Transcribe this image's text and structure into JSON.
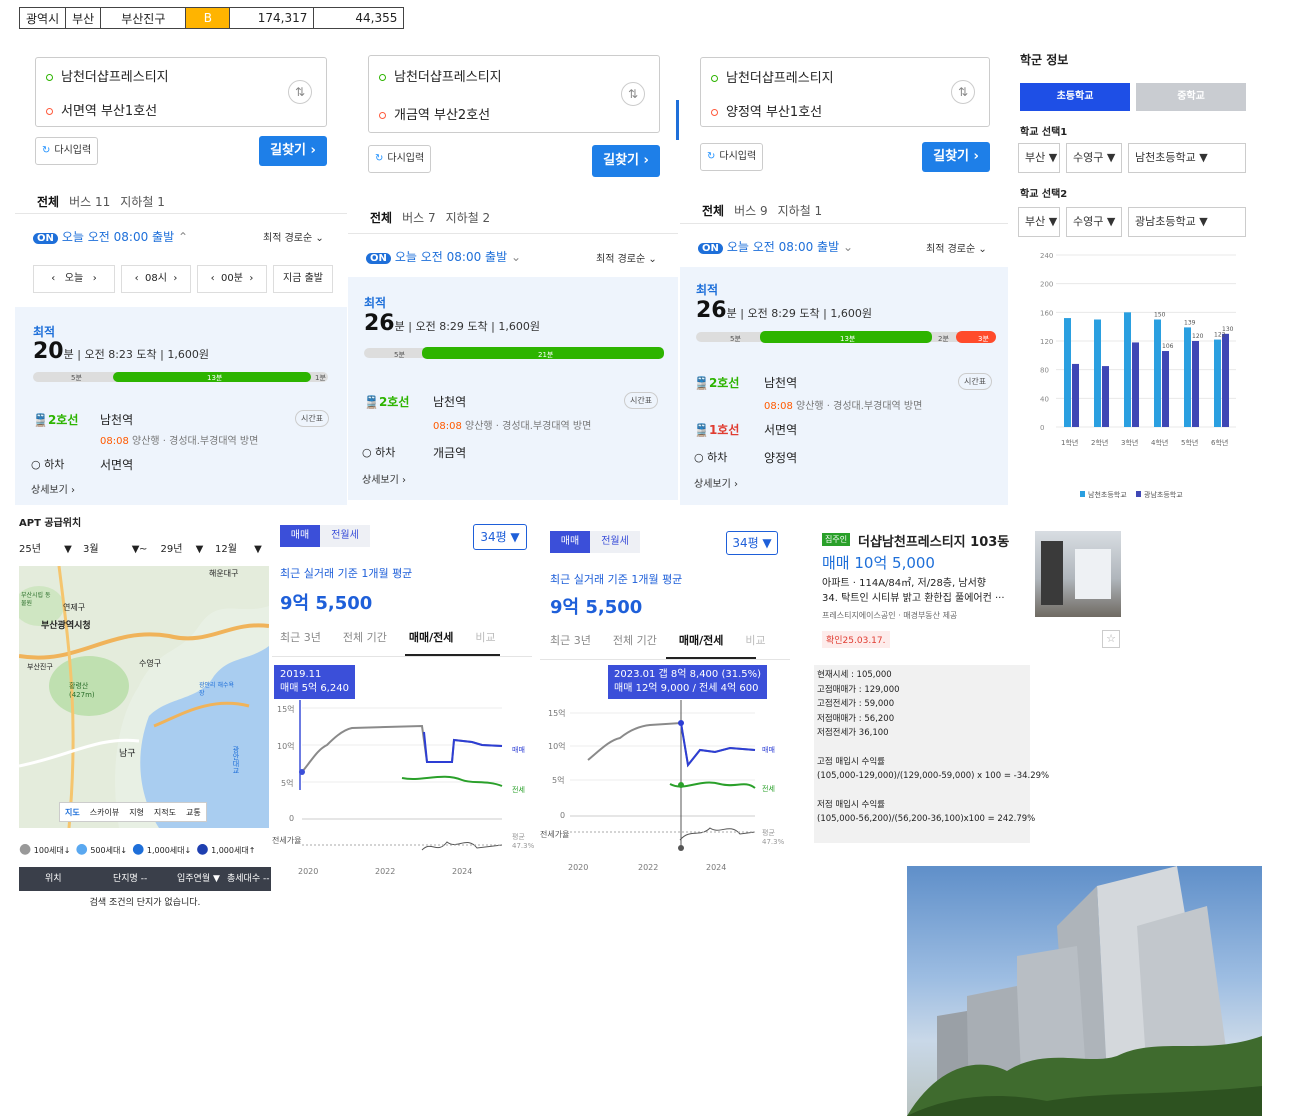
{
  "top_table": [
    "광역시",
    "부산",
    "부산진구",
    "B",
    "174,317",
    "44,355"
  ],
  "routes": [
    {
      "origin": "남천더샵프레스티지",
      "dest": "서면역 부산1호선",
      "reset": "다시입력",
      "find": "길찾기 ›",
      "tabs": [
        "전체",
        "버스 11",
        "지하철 1"
      ],
      "on": "ON",
      "depart": "오늘 오전 08:00 출발",
      "sort": "최적 경로순",
      "time_picker": [
        "‹",
        "오늘",
        "›",
        "‹",
        "08시",
        "›",
        "‹",
        "00분",
        "›",
        "지금 출발"
      ],
      "best": "최적",
      "min": "20",
      "min_unit": "분",
      "arrive": "오전 8:23 도착",
      "fare": "1,600원",
      "seg": [
        "5분",
        "13분",
        "1분"
      ],
      "line": "2호선",
      "station": "남천역",
      "dir_time": "08:08",
      "dir_rest": "양산행 · 경성대.부경대역 방면",
      "tt": "시간표",
      "off": "하차",
      "off_station": "서면역",
      "more": "상세보기 ›"
    },
    {
      "origin": "남천더샵프레스티지",
      "dest": "개금역 부산2호선",
      "reset": "다시입력",
      "find": "길찾기 ›",
      "tabs": [
        "전체",
        "버스 7",
        "지하철 2"
      ],
      "on": "ON",
      "depart": "오늘 오전 08:00 출발",
      "sort": "최적 경로순",
      "best": "최적",
      "min": "26",
      "min_unit": "분",
      "arrive": "오전 8:29 도착",
      "fare": "1,600원",
      "seg": [
        "5분",
        "21분"
      ],
      "line": "2호선",
      "station": "남천역",
      "dir_time": "08:08",
      "dir_rest": "양산행 · 경성대.부경대역 방면",
      "tt": "시간표",
      "off": "하차",
      "off_station": "개금역",
      "more": "상세보기 ›"
    },
    {
      "origin": "남천더샵프레스티지",
      "dest": "양정역 부산1호선",
      "reset": "다시입력",
      "find": "길찾기 ›",
      "tabs": [
        "전체",
        "버스 9",
        "지하철 1"
      ],
      "on": "ON",
      "depart": "오늘 오전 08:00 출발",
      "sort": "최적 경로순",
      "best": "최적",
      "min": "26",
      "min_unit": "분",
      "arrive": "오전 8:29 도착",
      "fare": "1,600원",
      "seg": [
        "5분",
        "13분",
        "2분",
        "3분"
      ],
      "line": "2호선",
      "station": "남천역",
      "dir_time": "08:08",
      "dir_rest": "양산행 · 경성대.부경대역 방면",
      "tt": "시간표",
      "line_b": "1호선",
      "station_b": "서면역",
      "off": "하차",
      "off_station": "양정역",
      "more": "상세보기 ›"
    }
  ],
  "school": {
    "title": "학군 정보",
    "tab_elem": "초등학교",
    "tab_mid": "중학교",
    "sel1_label": "학교 선택1",
    "sel1": [
      "부산 ▼",
      "수영구 ▼",
      "남천초등학교 ▼"
    ],
    "sel2_label": "학교 선택2",
    "sel2": [
      "부산 ▼",
      "수영구 ▼",
      "광남초등학교 ▼"
    ],
    "legend": [
      "남천초등학교",
      "광남초등학교"
    ]
  },
  "chart_data": {
    "type": "bar",
    "categories": [
      "1학년",
      "2학년",
      "3학년",
      "4학년",
      "5학년",
      "6학년"
    ],
    "yticks": [
      0,
      40,
      80,
      120,
      160,
      200,
      240
    ],
    "ylim": [
      0,
      240
    ],
    "series": [
      {
        "name": "남천초등학교",
        "values": [
          152,
          150,
          160,
          150,
          139,
          122
        ],
        "color": "#2a9fe0"
      },
      {
        "name": "광남초등학교",
        "values": [
          88,
          85,
          118,
          106,
          120,
          130
        ],
        "color": "#3f47b5"
      }
    ],
    "data_labels": [
      "150",
      "139",
      "106",
      "120",
      "122",
      "130"
    ],
    "legend": "bottom"
  },
  "apt": {
    "title": "APT 공급위치",
    "filters": [
      "25년 ▼",
      "3월 ▼",
      "~ 29년 ▼",
      "12월 ▼"
    ],
    "map_labels": [
      "해운대구",
      "연제구",
      "부산광역시청",
      "부산시립 동물원",
      "수영구",
      "황령산 (427m)",
      "남구",
      "부산진구",
      "광안리 해수욕장",
      "광안대교"
    ],
    "map_tabs": [
      "지도",
      "스카이뷰",
      "지형",
      "지적도",
      "교통"
    ],
    "legend": [
      "100세대↓",
      "500세대↓",
      "1,000세대↓",
      "1,000세대↑"
    ],
    "cols": [
      "위치",
      "단지명 --",
      "입주연월 ▼",
      "총세대수 --"
    ],
    "empty": "검색 조건의 단지가 없습니다."
  },
  "price_cards": [
    {
      "seg": [
        "매매",
        "전월세"
      ],
      "pyeong": "34평 ▼",
      "sub": "최근 실거래 기준 1개월 평균",
      "big": "9억 5,500",
      "tabs": [
        "최근 3년",
        "전체 기간",
        "매매/전세",
        "비교"
      ],
      "tip": [
        "2019.11",
        "매매 5억 6,240"
      ],
      "yticks": [
        "15억",
        "10억",
        "5억",
        "0"
      ],
      "labels": [
        "매매",
        "전세",
        "전세가율",
        "평균",
        "47.3%"
      ],
      "xticks": [
        "2020",
        "2022",
        "2024"
      ]
    },
    {
      "seg": [
        "매매",
        "전월세"
      ],
      "pyeong": "34평 ▼",
      "sub": "최근 실거래 기준 1개월 평균",
      "big": "9억 5,500",
      "tabs": [
        "최근 3년",
        "전체 기간",
        "매매/전세",
        "비교"
      ],
      "tip": [
        "2023.01 갭 8억 8,400 (31.5%)",
        "매매 12억 9,000 / 전세 4억 600"
      ],
      "yticks": [
        "15억",
        "10억",
        "5억",
        "0"
      ],
      "labels": [
        "매매",
        "전세",
        "전세가율",
        "평균",
        "47.3%"
      ],
      "xticks": [
        "2020",
        "2022",
        "2024"
      ]
    }
  ],
  "listing": {
    "badge": "집주인",
    "name": "더샵남천프레스티지 103동",
    "price": "매매 10억 5,000",
    "desc1": "아파트 · 114A/84㎡, 저/28층, 남서향",
    "desc2": "34. 탁트인 시티뷰 밝고 환한집 풀에어컨 ···",
    "agent": "프레스티지에이스공인 · 매경부동산 제공",
    "confirm": "확인25.03.17."
  },
  "calc": {
    "lines": [
      "현재시세 : 105,000",
      "고점매매가 : 129,000",
      "고점전세가 : 59,000",
      "저점매매가 : 56,200",
      "저점전세가 36,100"
    ],
    "t1": "고점 매입시 수익률",
    "f1": "(105,000-129,000)/(129,000-59,000) x 100 = -34.29%",
    "t2": "저점 매입시 수익률",
    "f2": "(105,000-56,200)/(56,200-36,100)x100 = 242.79%"
  }
}
